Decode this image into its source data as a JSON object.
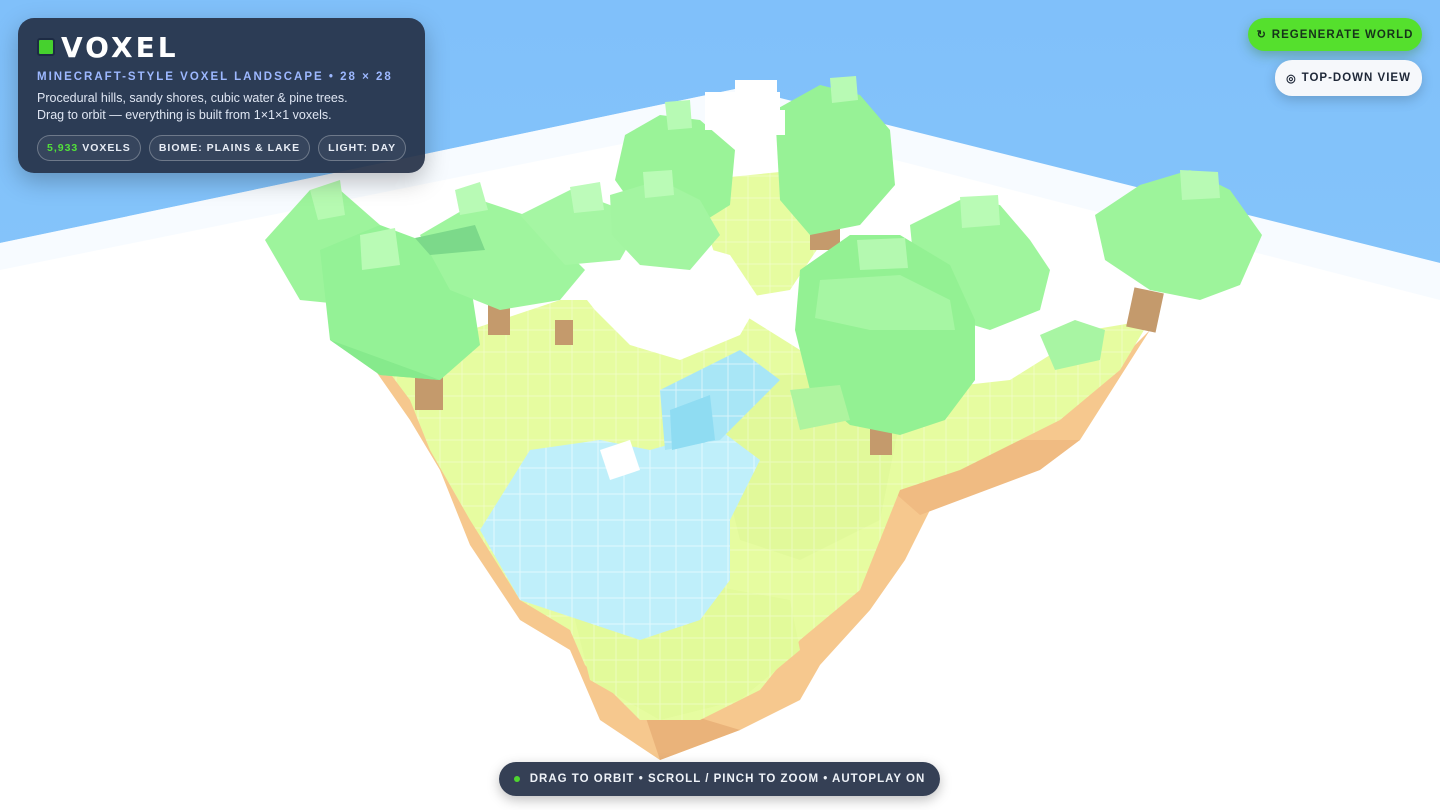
{
  "app": {
    "title": "VOXEL",
    "subtitle": "MINECRAFT-STYLE VOXEL LANDSCAPE • 28 × 28",
    "description_line1": "Procedural hills, sandy shores, cubic water & pine trees.",
    "description_line2": "Drag to orbit — everything is built from 1×1×1 voxels."
  },
  "stats": {
    "voxel_count": "5,933",
    "voxel_label": "VOXELS",
    "biome": "BIOME: PLAINS & LAKE",
    "light": "LIGHT: DAY"
  },
  "toolbar": {
    "regenerate_icon": "↻",
    "regenerate_label": "REGENERATE WORLD",
    "topdown_icon": "◎",
    "topdown_label": "TOP-DOWN VIEW"
  },
  "hint": {
    "text": "DRAG TO ORBIT • SCROLL / PINCH TO ZOOM • AUTOPLAY ON"
  },
  "colors": {
    "sky": "#86c4fa",
    "ground": "#ffffff",
    "grass": "#e6fca0",
    "dirt": "#f6c88e",
    "leaves": "#9cf59c",
    "trunk": "#c49a6c",
    "water": "#bff0fa",
    "accent": "#55e02d",
    "panel": "#263248"
  },
  "icons": [
    "cube-logo-icon",
    "refresh-icon",
    "target-icon",
    "status-dot-icon"
  ]
}
